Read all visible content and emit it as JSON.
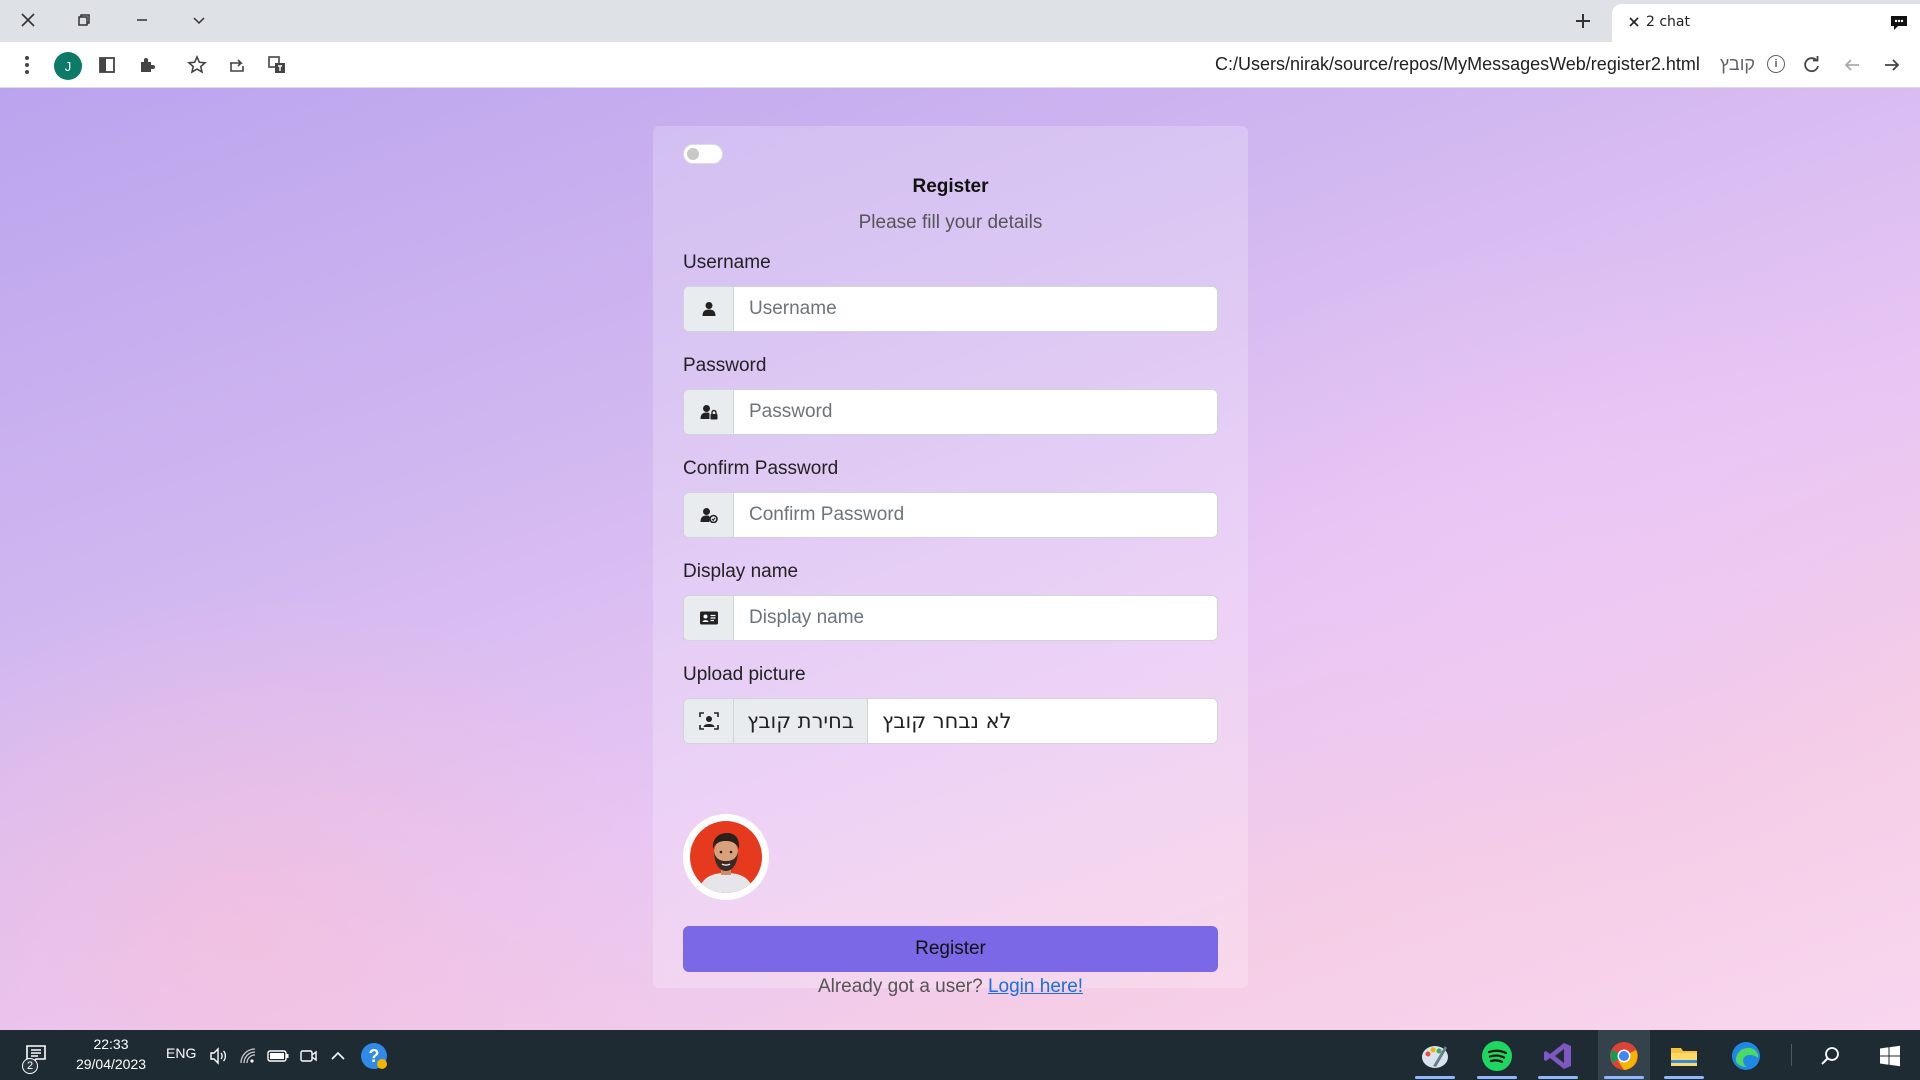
{
  "browser": {
    "tab_title": "2 chat",
    "url": "C:/Users/nirak/source/repos/MyMessagesWeb/register2.html",
    "url_chip": "קובץ",
    "profile_initial": "J"
  },
  "form": {
    "title": "Register",
    "subtitle": "Please fill your details",
    "username": {
      "label": "Username",
      "placeholder": "Username",
      "icon": "user-icon"
    },
    "password": {
      "label": "Password",
      "placeholder": "Password",
      "icon": "user-lock-icon"
    },
    "confirm_password": {
      "label": "Confirm Password",
      "placeholder": "Confirm Password",
      "icon": "user-check-icon"
    },
    "display_name": {
      "label": "Display name",
      "placeholder": "Display name",
      "icon": "id-card-icon"
    },
    "upload": {
      "label": "Upload picture",
      "button_label": "בחירת קובץ",
      "status": "לא נבחר קובץ",
      "icon": "portrait-icon"
    },
    "submit_label": "Register",
    "login_prompt": "Already got a user?",
    "login_link": "Login here!",
    "accent_color": "#7a68e6",
    "link_color": "#1a6ee0"
  },
  "taskbar": {
    "notification_count": "2",
    "time": "22:33",
    "date": "29/04/2023",
    "language": "ENG",
    "bg_color": "#1f2b33"
  }
}
